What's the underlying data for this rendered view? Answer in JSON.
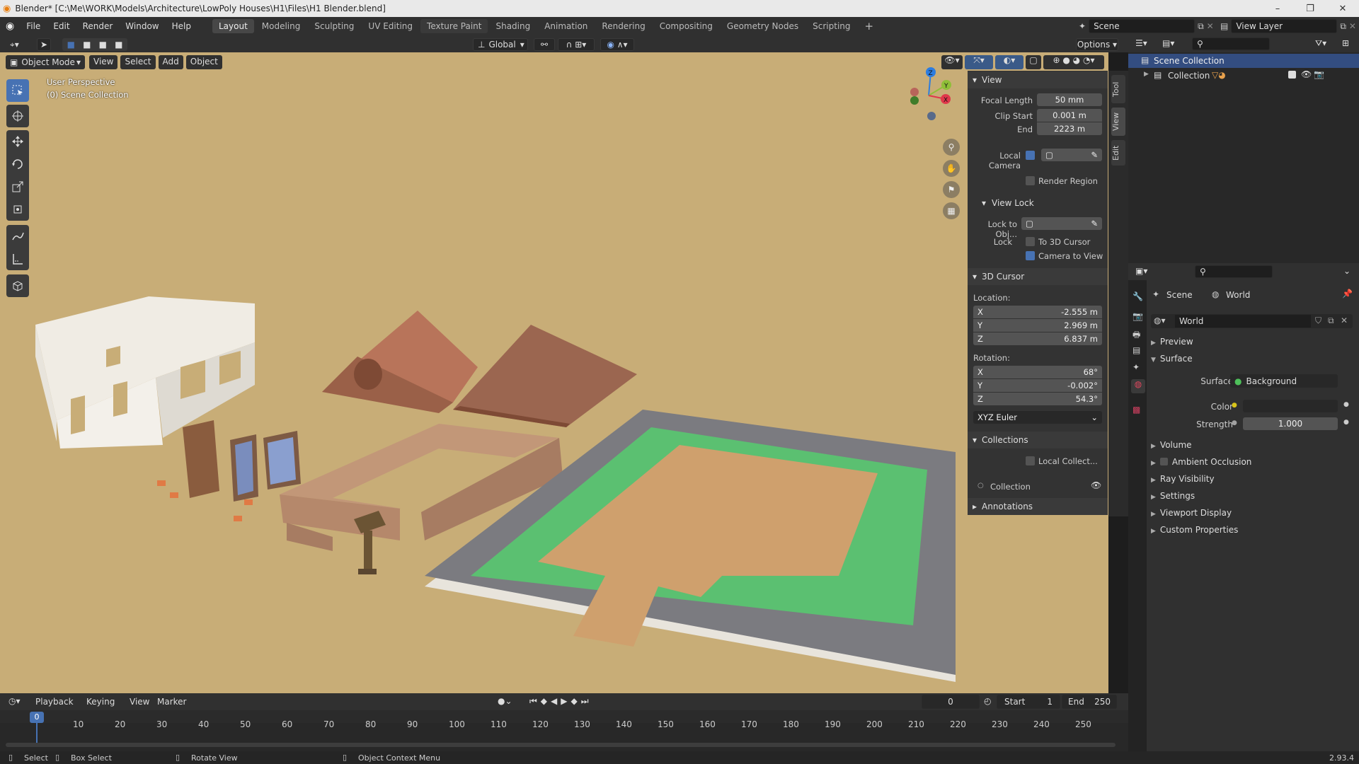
{
  "window": {
    "title": "Blender* [C:\\Me\\WORK\\Models\\Architecture\\LowPoly Houses\\H1\\Files\\H1 Blender.blend]",
    "controls": [
      "–",
      "❐",
      "✕"
    ]
  },
  "menus": [
    "File",
    "Edit",
    "Render",
    "Window",
    "Help"
  ],
  "workspaces": [
    {
      "label": "Layout",
      "active": true
    },
    {
      "label": "Modeling"
    },
    {
      "label": "Sculpting"
    },
    {
      "label": "UV Editing"
    },
    {
      "label": "Texture Paint"
    },
    {
      "label": "Shading"
    },
    {
      "label": "Animation"
    },
    {
      "label": "Rendering"
    },
    {
      "label": "Compositing"
    },
    {
      "label": "Geometry Nodes"
    },
    {
      "label": "Scripting"
    }
  ],
  "add_workspace": "+",
  "scene_field": "Scene",
  "view_layer_field": "View Layer",
  "viewport_header": {
    "mode": "Object Mode",
    "menus": [
      "View",
      "Select",
      "Add",
      "Object"
    ],
    "orientation": "Global",
    "options": "Options"
  },
  "viewport": {
    "perspective": "User Perspective",
    "collection": "(0) Scene Collection",
    "background": "#c8ad77"
  },
  "npanel": {
    "tabs": [
      "Tool",
      "View",
      "Edit"
    ],
    "view": {
      "title": "View",
      "focal_length_label": "Focal Length",
      "focal_length": "50 mm",
      "clip_start_label": "Clip Start",
      "clip_start": "0.001 m",
      "end_label": "End",
      "end": "2223 m",
      "local_camera_label": "Local Camera",
      "render_region_label": "Render Region"
    },
    "view_lock": {
      "title": "View Lock",
      "lock_to_obj_label": "Lock to Obj...",
      "lock_label": "Lock",
      "to_3d_cursor_label": "To 3D Cursor",
      "camera_to_view_label": "Camera to View"
    },
    "cursor": {
      "title": "3D Cursor",
      "location_label": "Location:",
      "rotation_label": "Rotation:",
      "location": [
        {
          "axis": "X",
          "value": "-2.555 m"
        },
        {
          "axis": "Y",
          "value": "2.969 m"
        },
        {
          "axis": "Z",
          "value": "6.837 m"
        }
      ],
      "rotation": [
        {
          "axis": "X",
          "value": "68°"
        },
        {
          "axis": "Y",
          "value": "-0.002°"
        },
        {
          "axis": "Z",
          "value": "54.3°"
        }
      ],
      "rotation_mode": "XYZ Euler"
    },
    "collections": {
      "title": "Collections",
      "local_collect_label": "Local Collect...",
      "collection_item": "Collection"
    },
    "annotations": {
      "title": "Annotations"
    }
  },
  "outliner": {
    "scene_collection": "Scene Collection",
    "collection": "Collection"
  },
  "properties": {
    "scene_label": "Scene",
    "world_label": "World",
    "world_datablock": "World",
    "sections": {
      "preview": "Preview",
      "surface": "Surface",
      "volume": "Volume",
      "ambient_occlusion": "Ambient Occlusion",
      "ray_visibility": "Ray Visibility",
      "settings": "Settings",
      "viewport_display": "Viewport Display",
      "custom_properties": "Custom Properties"
    },
    "surface_label": "Surface",
    "surface_value": "Background",
    "color_label": "Color",
    "strength_label": "Strength",
    "strength_value": "1.000"
  },
  "timeline": {
    "menus": [
      "Playback",
      "Keying",
      "View",
      "Marker"
    ],
    "current_frame": "0",
    "start_label": "Start",
    "start_value": "1",
    "end_label": "End",
    "end_value": "250",
    "playhead": "0",
    "ticks": [
      "10",
      "20",
      "30",
      "40",
      "50",
      "60",
      "70",
      "80",
      "90",
      "100",
      "110",
      "120",
      "130",
      "140",
      "150",
      "160",
      "170",
      "180",
      "190",
      "200",
      "210",
      "220",
      "230",
      "240",
      "250"
    ]
  },
  "statusbar": {
    "select": "Select",
    "box_select": "Box Select",
    "rotate_view": "Rotate View",
    "context_menu": "Object Context Menu",
    "version": "2.93.4"
  }
}
